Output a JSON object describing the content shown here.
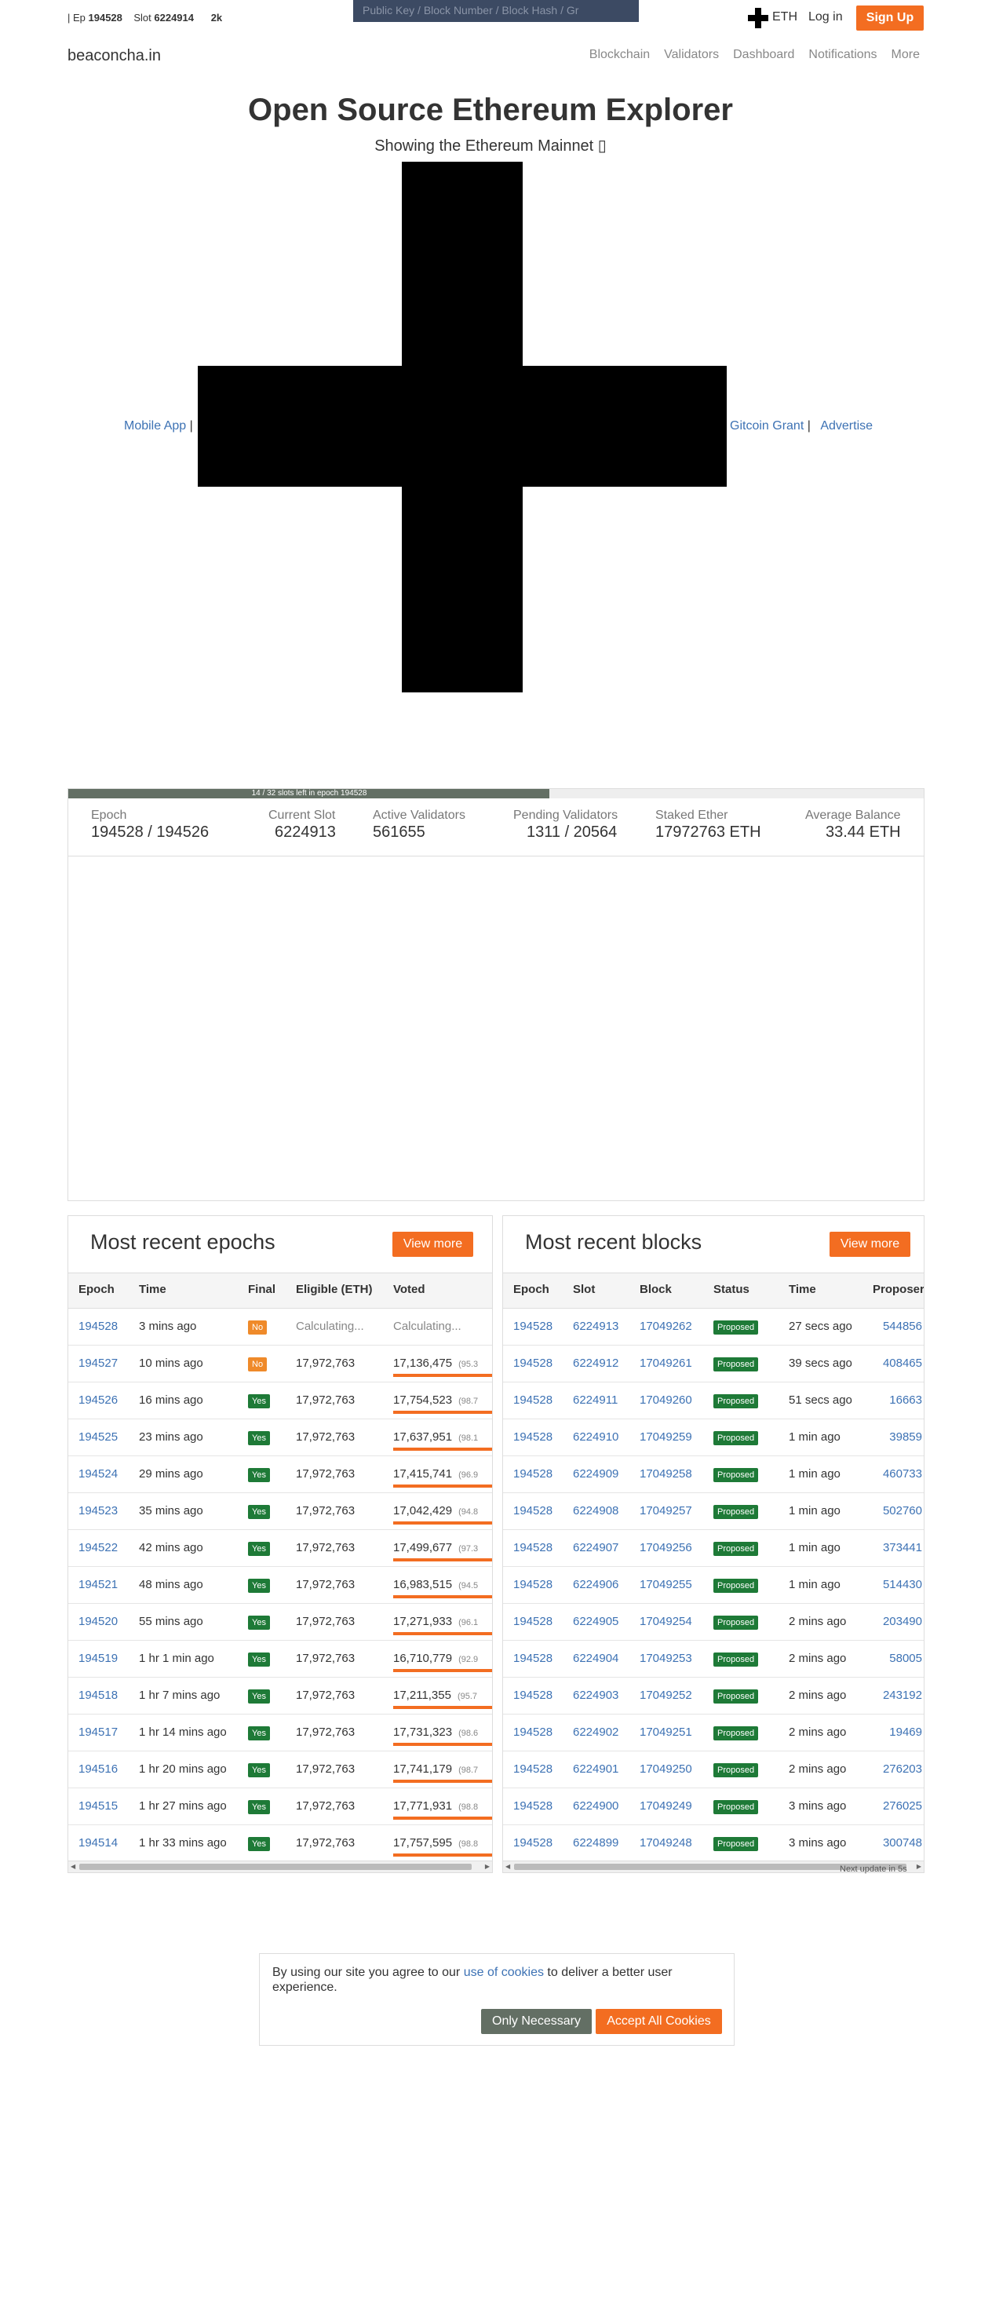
{
  "topbar": {
    "epoch_prefix": "|  Ep",
    "epoch": "194528",
    "slot_label": "Slot",
    "slot": "6224914",
    "extra": "2k",
    "search_placeholder": "Public Key / Block Number / Block Hash / Gr",
    "currency": "ETH",
    "login": "Log in",
    "signup": "Sign Up"
  },
  "nav": {
    "brand": "beaconcha.in",
    "items": [
      "Blockchain",
      "Validators",
      "Dashboard",
      "Notifications",
      "More"
    ]
  },
  "hero": {
    "title": "Open Source Ethereum Explorer",
    "subtitle": "Showing the Ethereum Mainnet ▯",
    "links": {
      "mobile_app": "Mobile App",
      "gitcoin": "Gitcoin Grant",
      "advertise": "Advertise",
      "sep": "|"
    }
  },
  "progress": {
    "text": "14 / 32 slots left in epoch 194528",
    "fraction": 0.5625
  },
  "stats": {
    "epoch_label": "Epoch",
    "epoch_value": "194528 / 194526",
    "slot_label": "Current Slot",
    "slot_value": "6224913",
    "active_label": "Active Validators",
    "active_value": "561655",
    "pending_label": "Pending Validators",
    "pending_value": "1311 / 20564",
    "staked_label": "Staked Ether",
    "staked_value": "17972763 ETH",
    "avg_label": "Average Balance",
    "avg_value": "33.44 ETH"
  },
  "epochs": {
    "title": "Most recent epochs",
    "view_more": "View more",
    "headers": [
      "Epoch",
      "Time",
      "Final",
      "Eligible (ETH)",
      "Voted"
    ],
    "rows": [
      {
        "epoch": "194528",
        "time": "3 mins ago",
        "final": "No",
        "eligible": "Calculating...",
        "voted": "Calculating...",
        "pct": ""
      },
      {
        "epoch": "194527",
        "time": "10 mins ago",
        "final": "No",
        "eligible": "17,972,763",
        "voted": "17,136,475",
        "pct": "(95.3"
      },
      {
        "epoch": "194526",
        "time": "16 mins ago",
        "final": "Yes",
        "eligible": "17,972,763",
        "voted": "17,754,523",
        "pct": "(98.7"
      },
      {
        "epoch": "194525",
        "time": "23 mins ago",
        "final": "Yes",
        "eligible": "17,972,763",
        "voted": "17,637,951",
        "pct": "(98.1"
      },
      {
        "epoch": "194524",
        "time": "29 mins ago",
        "final": "Yes",
        "eligible": "17,972,763",
        "voted": "17,415,741",
        "pct": "(96.9"
      },
      {
        "epoch": "194523",
        "time": "35 mins ago",
        "final": "Yes",
        "eligible": "17,972,763",
        "voted": "17,042,429",
        "pct": "(94.8"
      },
      {
        "epoch": "194522",
        "time": "42 mins ago",
        "final": "Yes",
        "eligible": "17,972,763",
        "voted": "17,499,677",
        "pct": "(97.3"
      },
      {
        "epoch": "194521",
        "time": "48 mins ago",
        "final": "Yes",
        "eligible": "17,972,763",
        "voted": "16,983,515",
        "pct": "(94.5"
      },
      {
        "epoch": "194520",
        "time": "55 mins ago",
        "final": "Yes",
        "eligible": "17,972,763",
        "voted": "17,271,933",
        "pct": "(96.1"
      },
      {
        "epoch": "194519",
        "time": "1 hr 1 min ago",
        "final": "Yes",
        "eligible": "17,972,763",
        "voted": "16,710,779",
        "pct": "(92.9"
      },
      {
        "epoch": "194518",
        "time": "1 hr 7 mins ago",
        "final": "Yes",
        "eligible": "17,972,763",
        "voted": "17,211,355",
        "pct": "(95.7"
      },
      {
        "epoch": "194517",
        "time": "1 hr 14 mins ago",
        "final": "Yes",
        "eligible": "17,972,763",
        "voted": "17,731,323",
        "pct": "(98.6"
      },
      {
        "epoch": "194516",
        "time": "1 hr 20 mins ago",
        "final": "Yes",
        "eligible": "17,972,763",
        "voted": "17,741,179",
        "pct": "(98.7"
      },
      {
        "epoch": "194515",
        "time": "1 hr 27 mins ago",
        "final": "Yes",
        "eligible": "17,972,763",
        "voted": "17,771,931",
        "pct": "(98.8"
      },
      {
        "epoch": "194514",
        "time": "1 hr 33 mins ago",
        "final": "Yes",
        "eligible": "17,972,763",
        "voted": "17,757,595",
        "pct": "(98.8"
      }
    ]
  },
  "blocks": {
    "title": "Most recent blocks",
    "view_more": "View more",
    "headers": [
      "Epoch",
      "Slot",
      "Block",
      "Status",
      "Time",
      "Proposer"
    ],
    "rows": [
      {
        "epoch": "194528",
        "slot": "6224913",
        "block": "17049262",
        "status": "Proposed",
        "time": "27 secs ago",
        "proposer": "544856"
      },
      {
        "epoch": "194528",
        "slot": "6224912",
        "block": "17049261",
        "status": "Proposed",
        "time": "39 secs ago",
        "proposer": "408465"
      },
      {
        "epoch": "194528",
        "slot": "6224911",
        "block": "17049260",
        "status": "Proposed",
        "time": "51 secs ago",
        "proposer": "16663"
      },
      {
        "epoch": "194528",
        "slot": "6224910",
        "block": "17049259",
        "status": "Proposed",
        "time": "1 min ago",
        "proposer": "39859"
      },
      {
        "epoch": "194528",
        "slot": "6224909",
        "block": "17049258",
        "status": "Proposed",
        "time": "1 min ago",
        "proposer": "460733"
      },
      {
        "epoch": "194528",
        "slot": "6224908",
        "block": "17049257",
        "status": "Proposed",
        "time": "1 min ago",
        "proposer": "502760"
      },
      {
        "epoch": "194528",
        "slot": "6224907",
        "block": "17049256",
        "status": "Proposed",
        "time": "1 min ago",
        "proposer": "373441"
      },
      {
        "epoch": "194528",
        "slot": "6224906",
        "block": "17049255",
        "status": "Proposed",
        "time": "1 min ago",
        "proposer": "514430"
      },
      {
        "epoch": "194528",
        "slot": "6224905",
        "block": "17049254",
        "status": "Proposed",
        "time": "2 mins ago",
        "proposer": "203490"
      },
      {
        "epoch": "194528",
        "slot": "6224904",
        "block": "17049253",
        "status": "Proposed",
        "time": "2 mins ago",
        "proposer": "58005"
      },
      {
        "epoch": "194528",
        "slot": "6224903",
        "block": "17049252",
        "status": "Proposed",
        "time": "2 mins ago",
        "proposer": "243192"
      },
      {
        "epoch": "194528",
        "slot": "6224902",
        "block": "17049251",
        "status": "Proposed",
        "time": "2 mins ago",
        "proposer": "19469"
      },
      {
        "epoch": "194528",
        "slot": "6224901",
        "block": "17049250",
        "status": "Proposed",
        "time": "2 mins ago",
        "proposer": "276203"
      },
      {
        "epoch": "194528",
        "slot": "6224900",
        "block": "17049249",
        "status": "Proposed",
        "time": "3 mins ago",
        "proposer": "276025"
      },
      {
        "epoch": "194528",
        "slot": "6224899",
        "block": "17049248",
        "status": "Proposed",
        "time": "3 mins ago",
        "proposer": "300748"
      }
    ],
    "next_update": "Next update in 5s"
  },
  "cookie": {
    "text_before": "By using our site you agree to our ",
    "link": "use of cookies",
    "text_after": " to deliver a better user experience.",
    "only_necessary": "Only Necessary",
    "accept_all": "Accept All Cookies"
  },
  "colors": {
    "accent": "#f36d21",
    "link": "#3d72b4",
    "success": "#1e7a37",
    "warning": "#ef8a2a",
    "search_bg": "#3c4a63"
  }
}
